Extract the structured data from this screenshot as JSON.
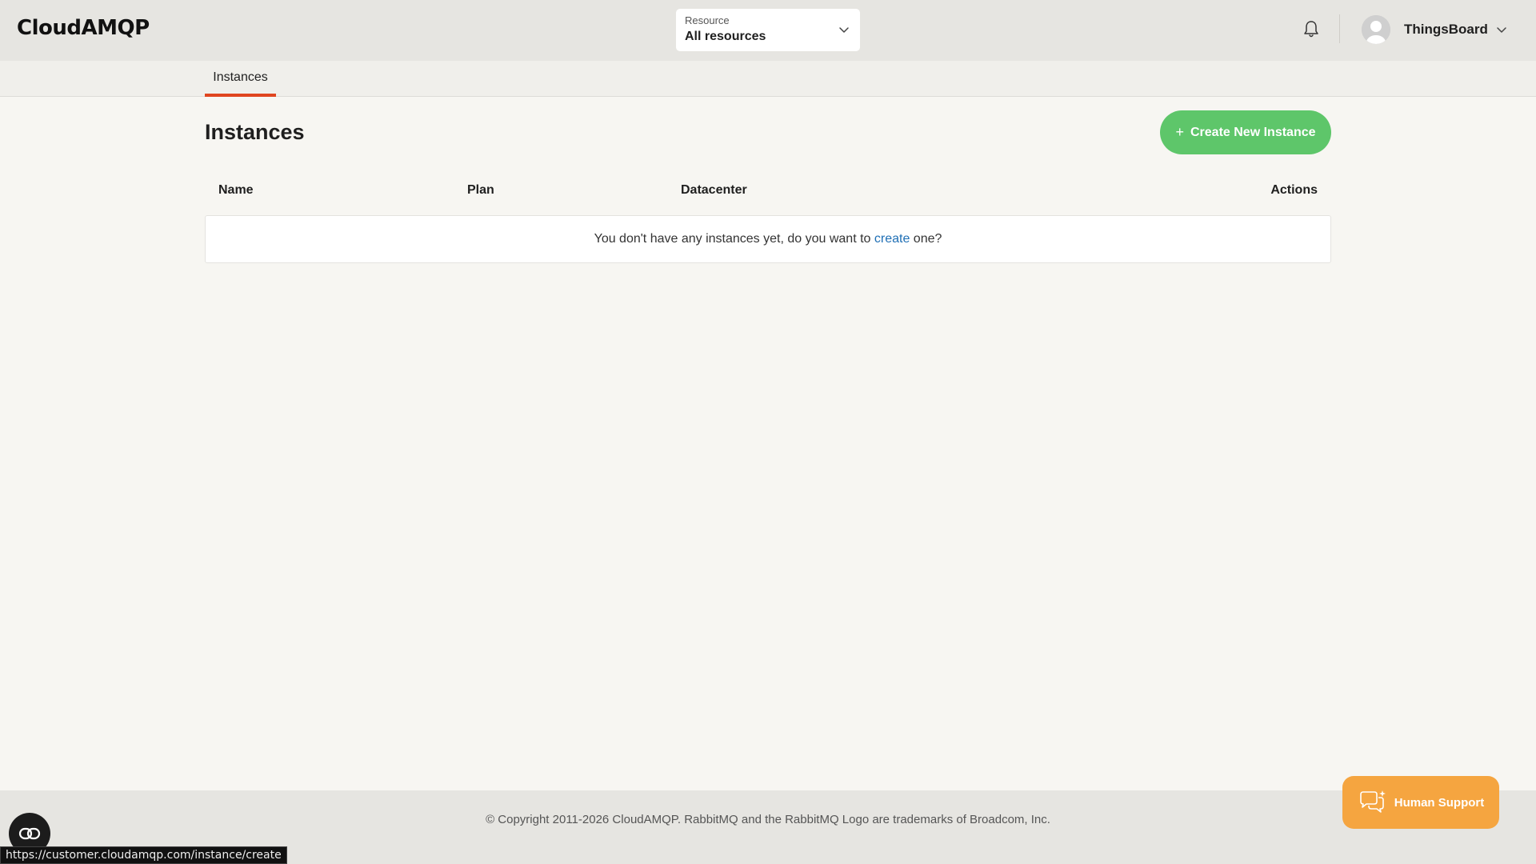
{
  "header": {
    "logo": "CloudAMQP",
    "resource": {
      "label": "Resource",
      "value": "All resources"
    },
    "user_name": "ThingsBoard"
  },
  "subnav": {
    "tab_label": "Instances"
  },
  "main": {
    "title": "Instances",
    "create_button": "Create New Instance",
    "table": {
      "columns": [
        "Name",
        "Plan",
        "Datacenter",
        "Actions"
      ],
      "empty_prefix": "You don't have any instances yet, do you want to ",
      "empty_link": "create",
      "empty_suffix": " one?"
    }
  },
  "footer": {
    "copyright": "© Copyright 2011-2026 CloudAMQP. RabbitMQ and the RabbitMQ Logo are trademarks of Broadcom, Inc."
  },
  "support_button": "Human Support",
  "status_url": "https://customer.cloudamqp.com/instance/create",
  "colors": {
    "accent_tab": "#e0451f",
    "create_button": "#5ec66a",
    "support_button": "#f5a540",
    "link": "#1f6fb5"
  }
}
